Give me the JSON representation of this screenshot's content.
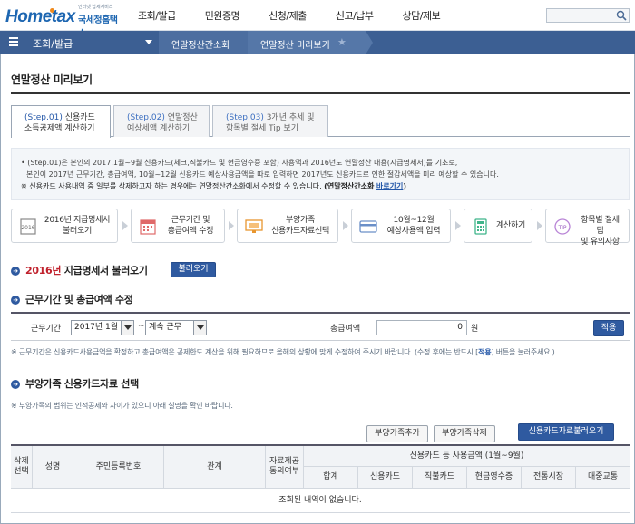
{
  "header": {
    "logo_small": "인터넷 납세서비스",
    "logo_main": "Hometax",
    "logo_org": "국세청홈택스",
    "nav": [
      "조회/발급",
      "민원증명",
      "신청/제출",
      "신고/납부",
      "상담/제보"
    ]
  },
  "breadcrumb": {
    "current": "조회/발급",
    "item1": "연말정산간소화",
    "item2": "연말정산 미리보기"
  },
  "page_title": "연말정산 미리보기",
  "tabs": [
    {
      "step": "(Step.01)",
      "line1": "신용카드",
      "line2": "소득공제액 계산하기"
    },
    {
      "step": "(Step.02)",
      "line1": "연말정산",
      "line2": "예상세액 계산하기"
    },
    {
      "step": "(Step.03)",
      "line1": "3개년 추세 및",
      "line2": "항목별 절세 Tip 보기"
    }
  ],
  "info": {
    "line1": "• (Step.01)은 본인의 2017.1월~9월 신용카드(체크,직불카드 및 현금영수증 포함) 사용액과 2016년도 연말정산 내용(지급명세서)를 기초로,",
    "line2": "본인이 2017년 근무기간, 총급여액, 10월~12월 신용카드 예상사용금액을 따로 입력하면 2017년도 신용카드로 인한 절감세액을 미리 예상할 수 있습니다.",
    "line3": "※ 신용카드 사용내역 중 일부를 삭제하고자 하는 경우에는 연말정산간소화에서 수정할 수 있습니다.",
    "line3_bold": "(연말정산간소화",
    "link": "바로가기",
    "line3_end": ")"
  },
  "steps": [
    {
      "line1": "2016년 지급명세서",
      "line2": "불러오기"
    },
    {
      "line1": "근무기간 및",
      "line2": "총급여액 수정"
    },
    {
      "line1": "부양가족",
      "line2": "신용카드자료선택"
    },
    {
      "line1": "10월~12월",
      "line2": "예상사용액 입력"
    },
    {
      "line1": "계산하기",
      "line2": ""
    },
    {
      "line1": "항목별 절세 팁",
      "line2": "및 유의사항"
    }
  ],
  "section1": {
    "year": "2016년",
    "title": "지급명세서 불러오기",
    "button": "불러오기"
  },
  "section2": {
    "title": "근무기간 및 총급여액 수정"
  },
  "form": {
    "period_label": "근무기간",
    "period_value": "2017년 1월",
    "tilde": "~",
    "period_end": "계속 근무",
    "salary_label": "총급여액",
    "salary_value": "0",
    "unit": "원",
    "apply": "적용"
  },
  "note1": {
    "text": "※ 근무기간은 신용카드사용금액을 확정하고 총급여액은 공제한도 계산을 위해 필요하므로 올해의 상황에 맞게 수정하여 주시기 바랍니다. (수정 후에는 반드시 [",
    "hl": "적용",
    "end": "] 버튼을 눌러주세요.)"
  },
  "section3": {
    "title": "부양가족 신용카드자료 선택"
  },
  "note2": "※ 부양가족의 범위는 인적공제와 차이가 있으니 아래 설명을 확인 바랍니다.",
  "buttons": {
    "add": "부양가족추가",
    "delete": "부양가족삭제",
    "load": "신용카드자료불러오기"
  },
  "table": {
    "col_select": [
      "삭제",
      "선택"
    ],
    "col_name": "성명",
    "col_id": "주민등록번호",
    "col_relation": "관계",
    "col_consent": [
      "자료제공",
      "동의여부"
    ],
    "group": "신용카드 등 사용금액 (1월~9월)",
    "sub": [
      "합계",
      "신용카드",
      "직불카드",
      "현금영수증",
      "전통시장",
      "대중교통"
    ],
    "empty": "조회된 내역이 없습니다."
  }
}
